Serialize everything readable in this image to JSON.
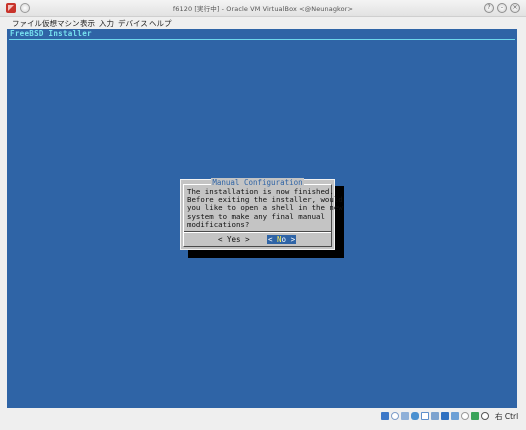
{
  "window": {
    "title": "f6120 [実行中] - Oracle VM VirtualBox <@Neunagkor>",
    "buttons": {
      "help": "?",
      "minimize": "-",
      "close": "×"
    }
  },
  "menubar": {
    "items": [
      "ファイル",
      "仮想マシン",
      "表示",
      "入力",
      "デバイス",
      "ヘルプ"
    ]
  },
  "vm": {
    "installer_title": "FreeBSD Installer",
    "dialog": {
      "title": "Manual Configuration",
      "message": "The installation is now finished.\nBefore exiting the installer, would\nyou like to open a shell in the new\nsystem to make any final manual\nmodifications?",
      "yes_button": "< Yes >",
      "no_button_open": "<",
      "no_button_hot": " N",
      "no_button_rest": "o >"
    }
  },
  "statusbar": {
    "host_key_label": "右 Ctrl",
    "icons": [
      "hard-disk",
      "optical-disk",
      "audio",
      "network",
      "usb",
      "shared-folders",
      "display",
      "video-capture",
      "mouse-integration",
      "cpu",
      "host-key"
    ],
    "colors": {
      "hard-disk": "#3c78c8",
      "optical-disk": "#8fb0d8",
      "audio": "#6a8fbf",
      "network": "#4a90d0",
      "usb": "#7da3cf",
      "shared-folders": "#5d8fcc",
      "display": "#2f70c0",
      "video-capture": "#6ca0d6",
      "mouse-integration": "#9a9a9a",
      "cpu": "#3aa35a",
      "host-key": "#555555"
    }
  }
}
